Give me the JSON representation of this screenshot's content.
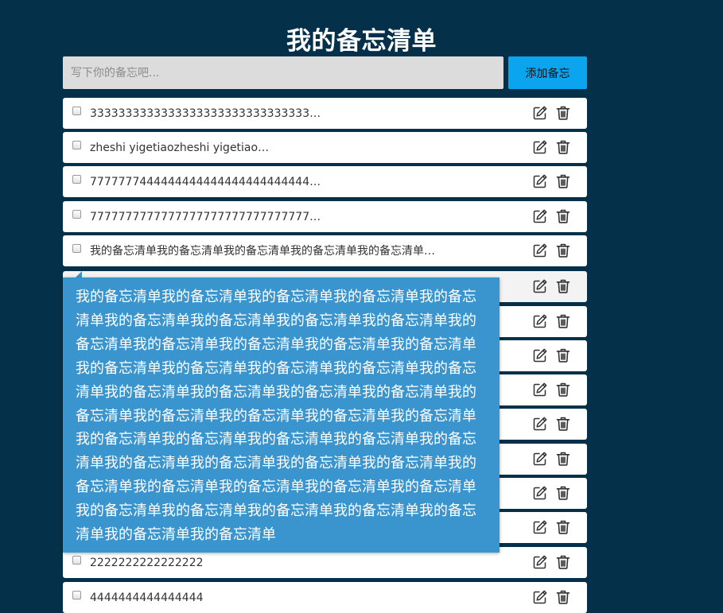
{
  "header": {
    "title": "我的备忘清单"
  },
  "add_form": {
    "placeholder": "写下你的备忘吧...",
    "button_label": "添加备忘"
  },
  "notes": [
    {
      "text": "3333333333333333333333333333333…",
      "checked": false
    },
    {
      "text": "zheshi yigetiaozheshi yigetiao…",
      "checked": false
    },
    {
      "text": "7777777444444444444444444444444…",
      "checked": false
    },
    {
      "text": "7777777777777777777777777777777…",
      "checked": false
    },
    {
      "text": "我的备忘清单我的备忘清单我的备忘清单我的备忘清单我的备忘清单…",
      "checked": false
    },
    {
      "text": "",
      "checked": false
    },
    {
      "text": "",
      "checked": false
    },
    {
      "text": "",
      "checked": false
    },
    {
      "text": "",
      "checked": false
    },
    {
      "text": "",
      "checked": false
    },
    {
      "text": "",
      "checked": false
    },
    {
      "text": "",
      "checked": false
    },
    {
      "text": "",
      "checked": false
    },
    {
      "text": "2222222222222222",
      "checked": false
    },
    {
      "text": "4444444444444444",
      "checked": false
    }
  ],
  "tooltip": {
    "text": "我的备忘清单我的备忘清单我的备忘清单我的备忘清单我的备忘清单我的备忘清单我的备忘清单我的备忘清单我的备忘清单我的备忘清单我的备忘清单我的备忘清单我的备忘清单我的备忘清单我的备忘清单我的备忘清单我的备忘清单我的备忘清单我的备忘清单我的备忘清单我的备忘清单我的备忘清单我的备忘清单我的备忘清单我的备忘清单我的备忘清单我的备忘清单我的备忘清单我的备忘清单我的备忘清单我的备忘清单我的备忘清单我的备忘清单我的备忘清单我的备忘清单我的备忘清单我的备忘清单我的备忘清单我的备忘清单我的备忘清单我的备忘清单我的备忘清单我的备忘清单我的备忘清单我的备忘清单我的备忘清单我的备忘清单我的备忘清单我的备忘清单"
  },
  "icons": {
    "edit": "edit-icon",
    "delete": "trash-icon"
  },
  "colors": {
    "background": "#053049",
    "accent": "#0ba5ef",
    "tooltip": "#3a95ce"
  }
}
